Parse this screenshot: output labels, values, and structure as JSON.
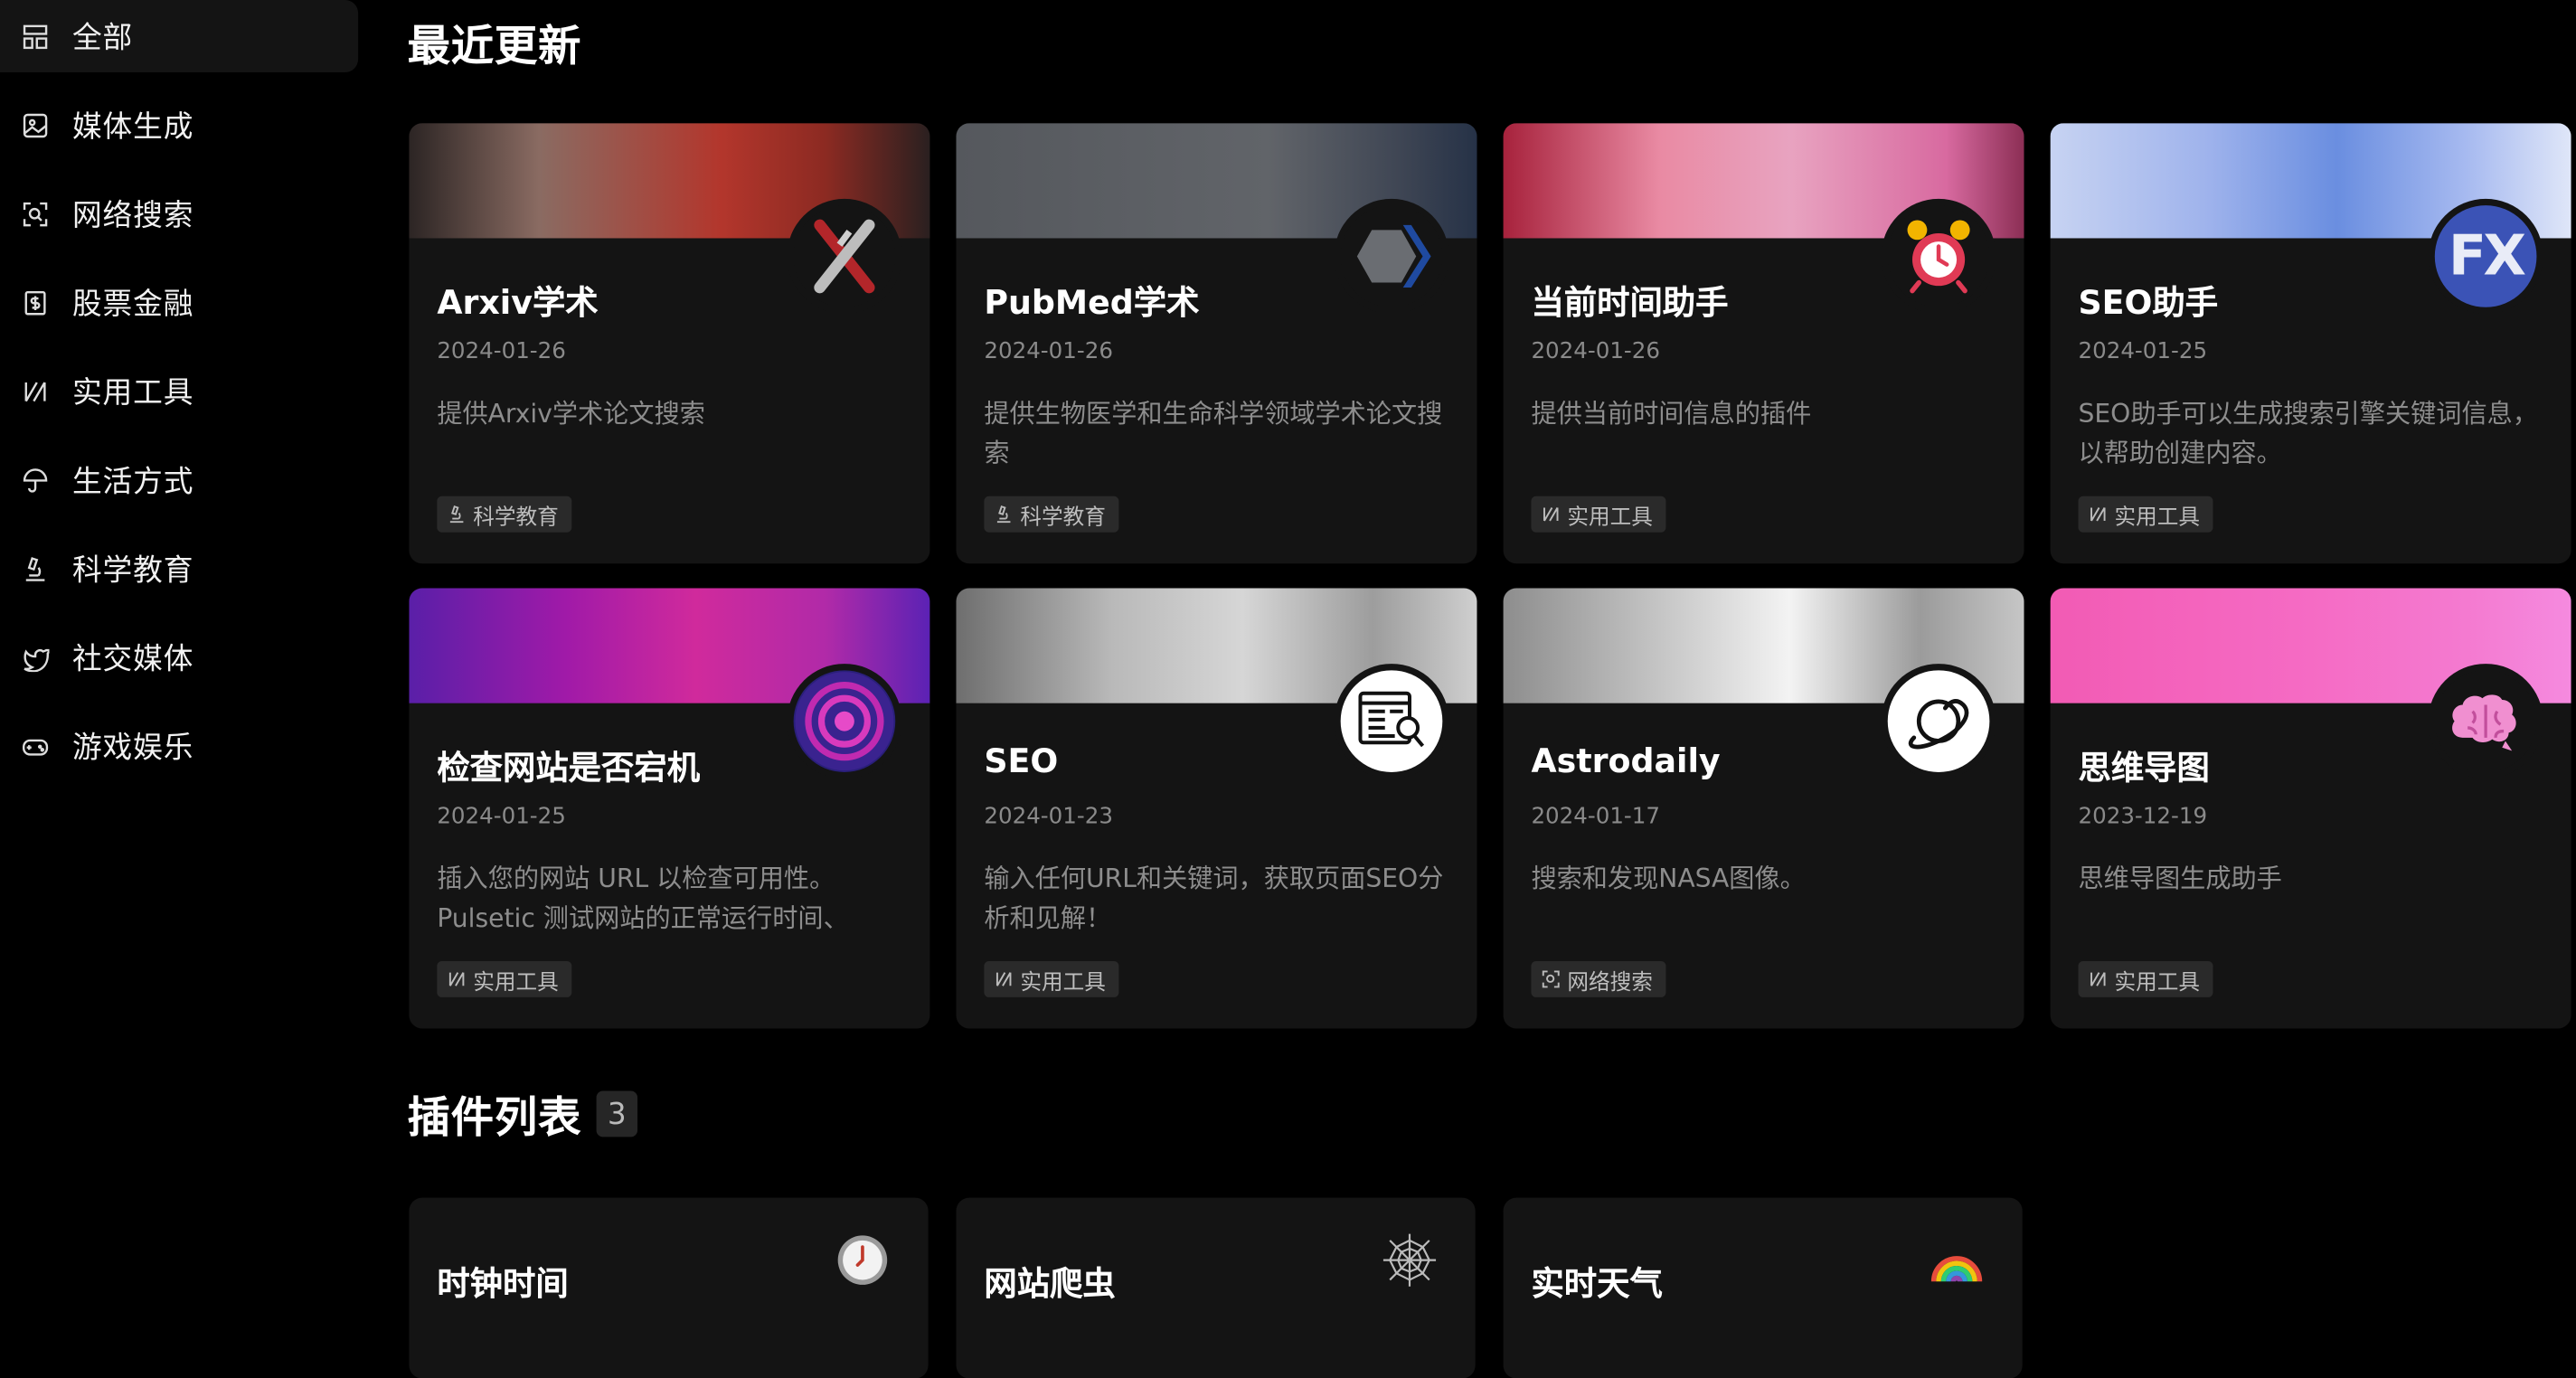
{
  "sidebar": {
    "items": [
      {
        "label": "全部",
        "icon": "grid-icon"
      },
      {
        "label": "媒体生成",
        "icon": "image-icon"
      },
      {
        "label": "网络搜索",
        "icon": "scan-search-icon"
      },
      {
        "label": "股票金融",
        "icon": "dollar-icon"
      },
      {
        "label": "实用工具",
        "icon": "tools-icon"
      },
      {
        "label": "生活方式",
        "icon": "umbrella-icon"
      },
      {
        "label": "科学教育",
        "icon": "microscope-icon"
      },
      {
        "label": "社交媒体",
        "icon": "twitter-icon"
      },
      {
        "label": "游戏娱乐",
        "icon": "gamepad-icon"
      }
    ]
  },
  "recent": {
    "title": "最近更新",
    "cards": [
      {
        "title": "Arxiv学术",
        "date": "2024-01-26",
        "desc": "提供Arxiv学术论文搜索",
        "tag": "科学教育",
        "icon": "arxiv-logo-icon"
      },
      {
        "title": "PubMed学术",
        "date": "2024-01-26",
        "desc": "提供生物医学和生命科学领域学术论文搜索",
        "tag": "科学教育",
        "icon": "pubmed-logo-icon"
      },
      {
        "title": "当前时间助手",
        "date": "2024-01-26",
        "desc": "提供当前时间信息的插件",
        "tag": "实用工具",
        "icon": "alarm-clock-icon"
      },
      {
        "title": "SEO助手",
        "date": "2024-01-25",
        "desc": "SEO助手可以生成搜索引擎关键词信息，以帮助创建内容。",
        "tag": "实用工具",
        "icon": "fx-logo-icon"
      },
      {
        "title": "检查网站是否宕机",
        "date": "2024-01-25",
        "desc": "插入您的网站 URL 以检查可用性。Pulsetic 测试网站的正常运行时间、可…",
        "tag": "实用工具",
        "icon": "pulse-target-icon"
      },
      {
        "title": "SEO",
        "date": "2024-01-23",
        "desc": "输入任何URL和关键词，获取页面SEO分析和见解！",
        "tag": "实用工具",
        "icon": "webpage-search-icon"
      },
      {
        "title": "Astrodaily",
        "date": "2024-01-17",
        "desc": "搜索和发现NASA图像。",
        "tag": "网络搜索",
        "icon": "planet-icon"
      },
      {
        "title": "思维导图",
        "date": "2023-12-19",
        "desc": "思维导图生成助手",
        "tag": "实用工具",
        "icon": "brain-icon"
      }
    ]
  },
  "plugins": {
    "title": "插件列表",
    "count": "3",
    "cards": [
      {
        "title": "时钟时间",
        "icon": "clock-icon"
      },
      {
        "title": "网站爬虫",
        "icon": "spider-web-icon"
      },
      {
        "title": "实时天气",
        "icon": "rainbow-icon"
      }
    ]
  },
  "colors": {
    "background": "#000000",
    "card": "#141414",
    "tag": "#2a2a2a"
  }
}
